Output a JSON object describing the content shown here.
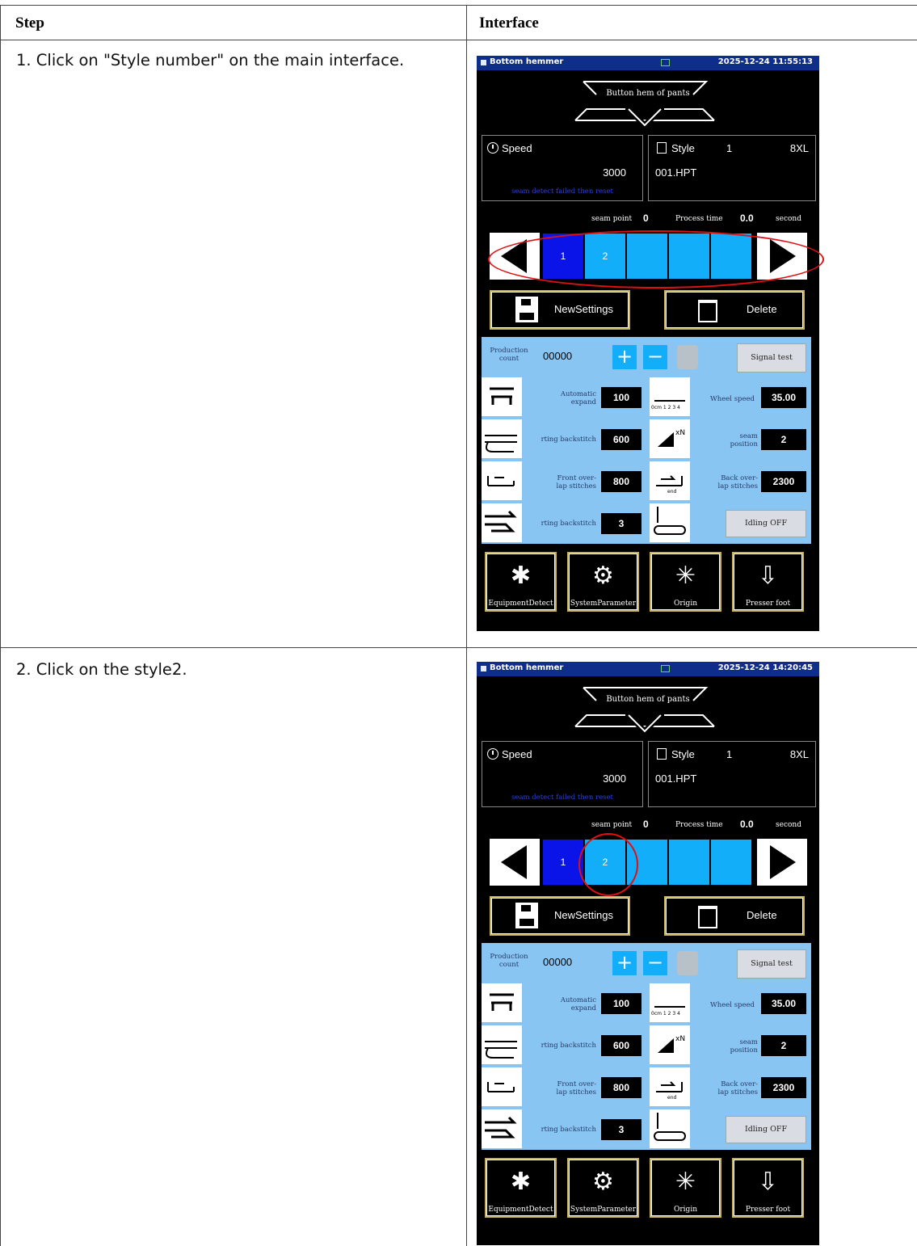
{
  "table": {
    "headers": {
      "step": "Step",
      "interface": "Interface"
    }
  },
  "rows": [
    {
      "step_text": "1. Click on \"Style number\" on the main interface.",
      "screen": {
        "title": "Bottom hemmer",
        "datetime": "2025-12-24 11:55:13",
        "product_name": "Button hem of pants",
        "speed_label": "Speed",
        "speed_value": "3000",
        "speed_note": "seam detect failed then reset",
        "style_label": "Style",
        "style_number": "1",
        "style_size": "8XL",
        "style_file": "001.HPT",
        "seam_point_label": "seam point",
        "seam_point_value": "0",
        "process_time_label": "Process time",
        "process_time_value": "0.0",
        "process_time_unit": "second",
        "style_slots": [
          "1",
          "2",
          "",
          "",
          ""
        ],
        "selected_slot": 0,
        "new_settings_label": "NewSettings",
        "delete_label": "Delete",
        "production_count_label": "Production\ncount",
        "production_count_value": "00000",
        "signal_test_label": "Signal test",
        "automatic_expand_label": "Automatic\nexpand",
        "automatic_expand_value": "100",
        "wheel_speed_label": "Wheel speed",
        "wheel_speed_value": "35.00",
        "backstitch_label": "rting backstitch",
        "backstitch_value": "600",
        "seam_position_label": "seam\nposition",
        "seam_position_value": "2",
        "front_overlap_label": "Front over-\nlap stitches",
        "front_overlap_value": "800",
        "back_overlap_label": "Back over-\nlap stitches",
        "back_overlap_value": "2300",
        "backstitch2_label": "rting backstitch",
        "backstitch2_value": "3",
        "idling_label": "Idling OFF",
        "ruler_caption": "0cm 1 2 3 4",
        "xn_caption": "xN",
        "end_caption": "end",
        "bottom_buttons": [
          "EquipmentDetect",
          "SystemParameter",
          "Origin",
          "Presser foot"
        ]
      }
    },
    {
      "step_text": "2. Click on the style2.",
      "screen": {
        "title": "Bottom hemmer",
        "datetime": "2025-12-24 14:20:45",
        "product_name": "Button hem of pants",
        "speed_label": "Speed",
        "speed_value": "3000",
        "speed_note": "seam detect failed then reset",
        "style_label": "Style",
        "style_number": "1",
        "style_size": "8XL",
        "style_file": "001.HPT",
        "seam_point_label": "seam point",
        "seam_point_value": "0",
        "process_time_label": "Process time",
        "process_time_value": "0.0",
        "process_time_unit": "second",
        "style_slots": [
          "1",
          "2",
          "",
          "",
          ""
        ],
        "selected_slot": 0,
        "new_settings_label": "NewSettings",
        "delete_label": "Delete",
        "production_count_label": "Production\ncount",
        "production_count_value": "00000",
        "signal_test_label": "Signal test",
        "automatic_expand_label": "Automatic\nexpand",
        "automatic_expand_value": "100",
        "wheel_speed_label": "Wheel speed",
        "wheel_speed_value": "35.00",
        "backstitch_label": "rting backstitch",
        "backstitch_value": "600",
        "seam_position_label": "seam\nposition",
        "seam_position_value": "2",
        "front_overlap_label": "Front over-\nlap stitches",
        "front_overlap_value": "800",
        "back_overlap_label": "Back over-\nlap stitches",
        "back_overlap_value": "2300",
        "backstitch2_label": "rting backstitch",
        "backstitch2_value": "3",
        "idling_label": "Idling OFF",
        "ruler_caption": "0cm 1 2 3 4",
        "xn_caption": "xN",
        "end_caption": "end",
        "bottom_buttons": [
          "EquipmentDetect",
          "SystemParameter",
          "Origin",
          "Presser foot"
        ]
      }
    }
  ],
  "colors": {
    "title_bar": "#0f2d8a",
    "slot_selected": "#0a14e8",
    "slot": "#12aefa",
    "panel": "#88c5f2",
    "highlight": "#e01010"
  }
}
